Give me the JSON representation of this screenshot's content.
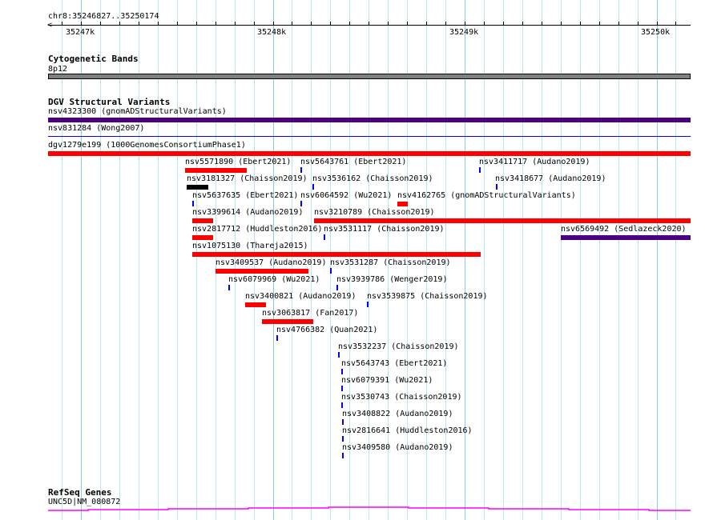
{
  "ruler": {
    "location": "chr8:35246827..35250174",
    "start": 35246827,
    "end": 35250174,
    "tick_labels": [
      "35247k",
      "35248k",
      "35249k",
      "35250k"
    ]
  },
  "tracks": {
    "cytoband": {
      "title": "Cytogenetic Bands",
      "band": "8p12",
      "color": "#808080"
    },
    "dgv": {
      "title": "DGV Structural Variants",
      "wide": [
        {
          "label": "nsv4323300 (gnomADStructuralVariants)",
          "color": "#4b0082"
        },
        {
          "label": "nsv831284 (Wong2007)",
          "color": "#0000ff"
        },
        {
          "label": "dgv1279e199 (1000GenomesConsortiumPhase1)",
          "color": "#ff0000"
        }
      ],
      "features": [
        {
          "label": "nsv5571890 (Ebert2021)",
          "color": "#ff0000"
        },
        {
          "label": "nsv5643761 (Ebert2021)",
          "color": "#0000ff"
        },
        {
          "label": "nsv3411717 (Audano2019)",
          "color": "#0000ff"
        },
        {
          "label": "nsv3181327 (Chaisson2019)",
          "color": "#000000"
        },
        {
          "label": "nsv3536162 (Chaisson2019)",
          "color": "#0000ff"
        },
        {
          "label": "nsv3418677 (Audano2019)",
          "color": "#0000ff"
        },
        {
          "label": "nsv5637635 (Ebert2021)",
          "color": "#0000ff"
        },
        {
          "label": "nsv6064592 (Wu2021)",
          "color": "#0000ff"
        },
        {
          "label": "nsv4162765 (gnomADStructuralVariants)",
          "color": "#ff0000"
        },
        {
          "label": "nsv3399614 (Audano2019)",
          "color": "#ff0000"
        },
        {
          "label": "nsv3210789 (Chaisson2019)",
          "color": "#ff0000"
        },
        {
          "label": "nsv2817712 (Huddleston2016)",
          "color": "#ff0000"
        },
        {
          "label": "nsv3531117 (Chaisson2019)",
          "color": "#0000ff"
        },
        {
          "label": "nsv6569492 (Sedlazeck2020)",
          "color": "#4b0082"
        },
        {
          "label": "nsv1075130 (Thareja2015)",
          "color": "#ff0000"
        },
        {
          "label": "nsv3409537 (Audano2019)",
          "color": "#ff0000"
        },
        {
          "label": "nsv3531287 (Chaisson2019)",
          "color": "#0000ff"
        },
        {
          "label": "nsv6079969 (Wu2021)",
          "color": "#0000ff"
        },
        {
          "label": "nsv3939786 (Wenger2019)",
          "color": "#0000ff"
        },
        {
          "label": "nsv3400821 (Audano2019)",
          "color": "#ff0000"
        },
        {
          "label": "nsv3539875 (Chaisson2019)",
          "color": "#0000ff"
        },
        {
          "label": "nsv3063817 (Fan2017)",
          "color": "#ff0000"
        },
        {
          "label": "nsv4766382 (Quan2021)",
          "color": "#0000ff"
        },
        {
          "label": "nsv3532237 (Chaisson2019)",
          "color": "#0000ff"
        },
        {
          "label": "nsv5643743 (Ebert2021)",
          "color": "#0000ff"
        },
        {
          "label": "nsv6079391 (Wu2021)",
          "color": "#0000ff"
        },
        {
          "label": "nsv3530743 (Chaisson2019)",
          "color": "#0000ff"
        },
        {
          "label": "nsv3408822 (Audano2019)",
          "color": "#0000ff"
        },
        {
          "label": "nsv2816641 (Huddleston2016)",
          "color": "#0000ff"
        },
        {
          "label": "nsv3409580 (Audano2019)",
          "color": "#0000ff"
        }
      ]
    },
    "refseq": {
      "title": "RefSeq Genes",
      "gene": "UNC5D|NM_080872",
      "color": "#ff00ff"
    }
  }
}
